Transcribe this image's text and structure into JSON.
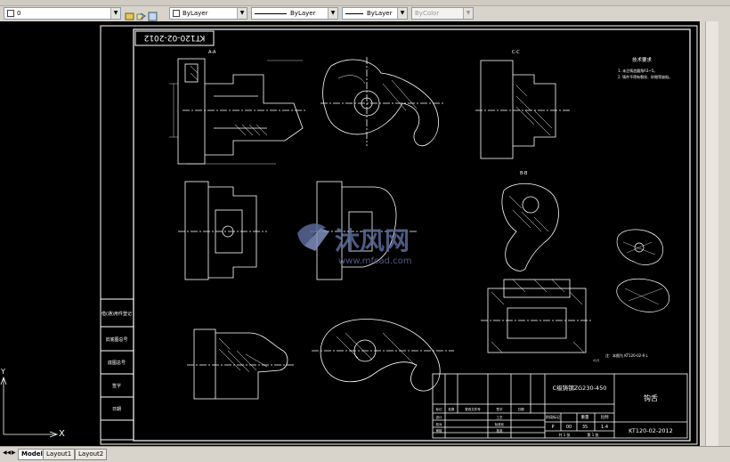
{
  "toolbar": {
    "layer_value": "0",
    "color_value": "ByLayer",
    "linetype_value": "ByLayer",
    "lineweight_value": "ByLayer",
    "plotstyle_value": "ByColor"
  },
  "tabs": [
    {
      "label": "Model",
      "active": true
    },
    {
      "label": "Layout1",
      "active": false
    },
    {
      "label": "Layout2",
      "active": false
    }
  ],
  "drawing": {
    "mirrored_code": "KT120-02-2012",
    "section_a": "A-A",
    "section_b": "B-B",
    "section_c": "C-C",
    "tech_req_title": "技术要求",
    "tech_req_1": "1. 未注铸造圆角R3~5。",
    "tech_req_2": "2. 铸件不得有裂纹、砂眼等缺陷。",
    "note_bottom": "注：本图为 KT120-02-9 L",
    "side_labels": [
      "借(通)用件登记",
      "旧底图总号",
      "底图总号",
      "签字",
      "日期"
    ],
    "title_material": "C级铸钢ZG230-450",
    "title_part": "钩舌",
    "title_code": "KT120-02-2012",
    "weight_label": "重量",
    "scale_label": "比例",
    "stage_label": "阶段标记",
    "stage_p": "P",
    "stage_00": "00",
    "weight_value": "35",
    "scale_value": "1:4",
    "sheet_total": "共 1 张",
    "sheet_no": "第 1 张",
    "rev_headers": [
      "标记",
      "处数",
      "更改文件号",
      "签字",
      "日期"
    ],
    "sign_rows": [
      "设计",
      "校对",
      "审核"
    ],
    "sign_rows_right": [
      "工艺",
      "标准化",
      "批准"
    ]
  },
  "watermark": {
    "brand": "沐风网",
    "url": "www.mfcad.com"
  },
  "colors": {
    "frame": "#ffffff",
    "geometry": "#ffffff",
    "dimension": "#ffffff",
    "watermark": "#5a6a9a"
  }
}
